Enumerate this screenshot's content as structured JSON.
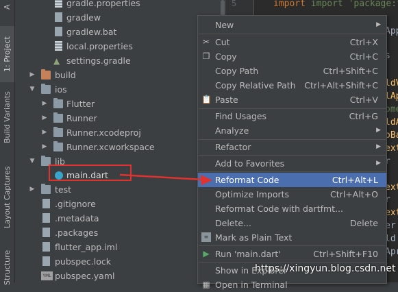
{
  "sidebar_tabs": [
    {
      "label": "1: Project",
      "active": true
    },
    {
      "label": "Build Variants",
      "active": false
    },
    {
      "label": "Layout Captures",
      "active": false
    },
    {
      "label": "Structure",
      "active": false
    }
  ],
  "tree": [
    {
      "label": "gradle.properties",
      "icon": "properties-file-icon"
    },
    {
      "label": "gradlew",
      "icon": "file-icon"
    },
    {
      "label": "gradlew.bat",
      "icon": "file-icon"
    },
    {
      "label": "local.properties",
      "icon": "properties-file-icon"
    },
    {
      "label": "settings.gradle",
      "icon": "gradle-icon"
    },
    {
      "label": "build",
      "icon": "folder-icon",
      "state": "collapsed"
    },
    {
      "label": "ios",
      "icon": "folder-icon",
      "state": "expanded"
    },
    {
      "label": "Flutter",
      "icon": "folder-icon",
      "state": "collapsed"
    },
    {
      "label": "Runner",
      "icon": "folder-icon",
      "state": "collapsed"
    },
    {
      "label": "Runner.xcodeproj",
      "icon": "folder-icon",
      "state": "collapsed"
    },
    {
      "label": "Runner.xcworkspace",
      "icon": "folder-icon",
      "state": "collapsed"
    },
    {
      "label": "lib",
      "icon": "folder-icon",
      "state": "expanded"
    },
    {
      "label": "main.dart",
      "icon": "dart-file-icon",
      "highlighted": true
    },
    {
      "label": "test",
      "icon": "folder-icon",
      "state": "collapsed"
    },
    {
      "label": ".gitignore",
      "icon": "file-icon"
    },
    {
      "label": ".metadata",
      "icon": "file-icon"
    },
    {
      "label": ".packages",
      "icon": "file-icon"
    },
    {
      "label": "flutter_app.iml",
      "icon": "file-icon"
    },
    {
      "label": "pubspec.lock",
      "icon": "file-icon"
    },
    {
      "label": "pubspec.yaml",
      "icon": "yaml-file-icon"
    }
  ],
  "editor": {
    "line_number": "5",
    "code_line": "import 'package:flut",
    "fragments": [
      "App",
      "s",
      "ldV",
      "lApp",
      "ome",
      "ldA",
      "oBar",
      "ext",
      "r",
      "ext",
      "r",
      "ext",
      "er",
      "ld",
      "Apr"
    ]
  },
  "context_menu": {
    "items": [
      {
        "label": "New",
        "shortcut": "",
        "submenu": true
      },
      {
        "label": "Cut",
        "shortcut": "Ctrl+X",
        "icon": "scissors-icon"
      },
      {
        "label": "Copy",
        "shortcut": "Ctrl+C",
        "icon": "copy-icon"
      },
      {
        "label": "Copy Path",
        "shortcut": "Ctrl+Shift+C"
      },
      {
        "label": "Copy Relative Path",
        "shortcut": "Ctrl+Alt+Shift+C"
      },
      {
        "label": "Paste",
        "shortcut": "Ctrl+V",
        "icon": "paste-icon"
      },
      {
        "label": "Find Usages",
        "shortcut": "Ctrl+G"
      },
      {
        "label": "Analyze",
        "shortcut": "",
        "submenu": true
      },
      {
        "label": "Refactor",
        "shortcut": "",
        "submenu": true
      },
      {
        "label": "Add to Favorites",
        "shortcut": "",
        "submenu": true
      },
      {
        "label": "Reformat Code",
        "shortcut": "Ctrl+Alt+L",
        "selected": true
      },
      {
        "label": "Optimize Imports",
        "shortcut": "Ctrl+Alt+O"
      },
      {
        "label": "Reformat Code with dartfmt...",
        "shortcut": ""
      },
      {
        "label": "Delete...",
        "shortcut": "Delete"
      },
      {
        "label": "Mark as Plain Text",
        "shortcut": "",
        "icon": "plain-text-icon"
      },
      {
        "label": "Run 'main.dart'",
        "shortcut": "Ctrl+Shift+F10",
        "icon": "run-icon"
      },
      {
        "label": "Show in Explorer",
        "shortcut": ""
      },
      {
        "label": "Open in Terminal",
        "shortcut": ""
      }
    ]
  },
  "watermark": "https://xingyun.blog.csdn.net",
  "colors": {
    "background": "#3c3f41",
    "editor_background": "#2b2b2b",
    "selection": "#4b6eaf",
    "annotation_red": "#e0332f",
    "keyword": "#cc7832",
    "string": "#6a8759"
  }
}
